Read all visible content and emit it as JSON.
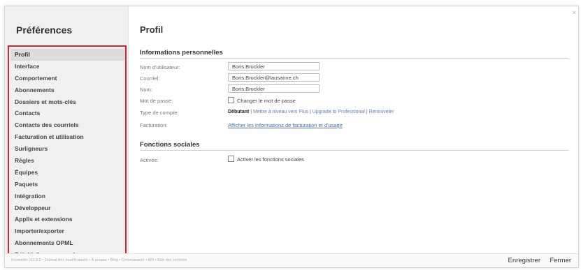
{
  "sidebar": {
    "title": "Préférences",
    "items": [
      {
        "label": "Profil"
      },
      {
        "label": "Interface"
      },
      {
        "label": "Comportement"
      },
      {
        "label": "Abonnements"
      },
      {
        "label": "Dossiers et mots-clés"
      },
      {
        "label": "Contacts"
      },
      {
        "label": "Contacts des courriels"
      },
      {
        "label": "Facturation et utilisation"
      },
      {
        "label": "Surligneurs"
      },
      {
        "label": "Règles"
      },
      {
        "label": "Équipes"
      },
      {
        "label": "Paquets"
      },
      {
        "label": "Intégration"
      },
      {
        "label": "Développeur"
      },
      {
        "label": "Applis et extensions"
      },
      {
        "label": "Importer/exporter"
      },
      {
        "label": "Abonnements OPML"
      },
      {
        "label": "Réinitialiser ou annuler"
      }
    ],
    "active_index": 0
  },
  "window": {
    "close_glyph": "×"
  },
  "main": {
    "title": "Profil",
    "personal": {
      "header": "Informations personnelles",
      "username_label": "Nom d'utilisateur:",
      "username_value": "Boris.Bruckler",
      "email_label": "Courriel:",
      "email_value": "Boris.Bruckler@lausanne.ch",
      "name_label": "Nom:",
      "name_value": "Boris.Bruckler",
      "password_label": "Mot de passe:",
      "password_checkbox": "Changer le mot de passe",
      "account_type_label": "Type de compte:",
      "account_current": "Débutant",
      "account_sep1": " | ",
      "account_link1": "Mettre à niveau vers Plus",
      "account_sep2": " | ",
      "account_link2": "Upgrade to Professional",
      "account_sep3": " | ",
      "account_link3": "Renouveler",
      "billing_label": "Facturation:",
      "billing_link": "Afficher les informations de facturation et d'usage"
    },
    "social": {
      "header": "Fonctions sociales",
      "enabled_label": "Activée:",
      "enabled_checkbox": "Activer les fonctions sociales"
    }
  },
  "footer": {
    "links": "Inoreader v11.3.2 • Journal des modifications • À propos • Blog • Communauté • API • Etat des services",
    "save_label": "Enregistrer",
    "close_label": "Fermer"
  }
}
